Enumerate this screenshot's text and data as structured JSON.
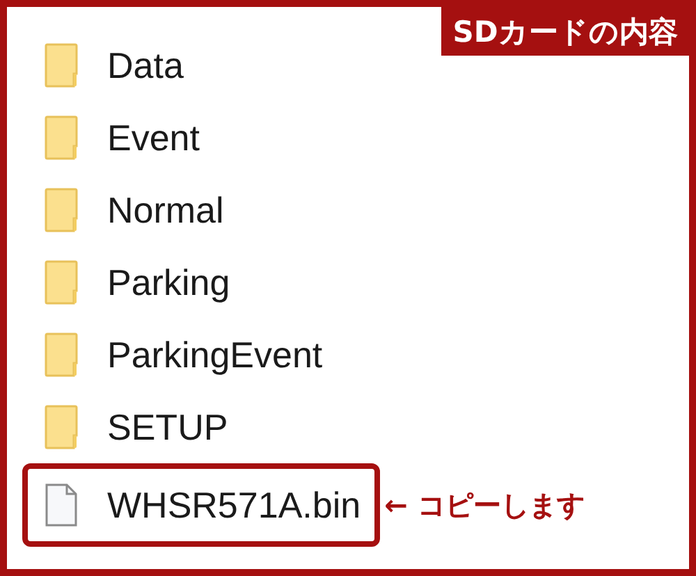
{
  "badge": "SDカードの内容",
  "items": [
    {
      "name": "Data",
      "kind": "folder",
      "highlighted": false
    },
    {
      "name": "Event",
      "kind": "folder",
      "highlighted": false
    },
    {
      "name": "Normal",
      "kind": "folder",
      "highlighted": false
    },
    {
      "name": "Parking",
      "kind": "folder",
      "highlighted": false
    },
    {
      "name": "ParkingEvent",
      "kind": "folder",
      "highlighted": false
    },
    {
      "name": "SETUP",
      "kind": "folder",
      "highlighted": false
    },
    {
      "name": "WHSR571A.bin",
      "kind": "file",
      "highlighted": true,
      "note": "← コピーします"
    }
  ]
}
